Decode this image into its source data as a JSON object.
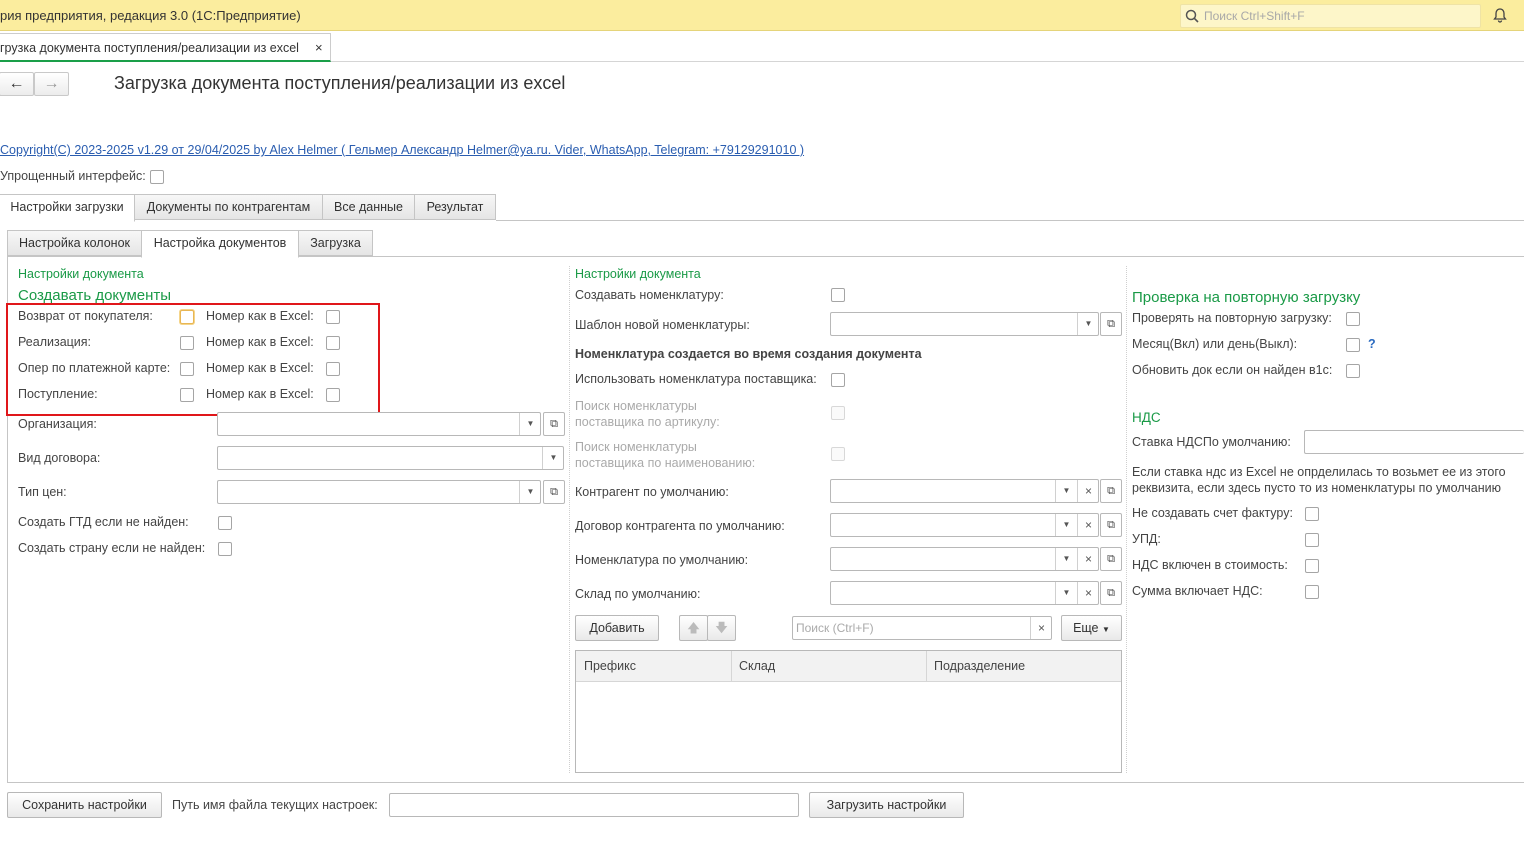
{
  "titlebar": {
    "app_title": "рия предприятия, редакция 3.0  (1С:Предприятие)",
    "search_placeholder": "Поиск Ctrl+Shift+F"
  },
  "doc_tab": {
    "label": "грузка документа поступления/реализации из excel",
    "close": "×"
  },
  "nav": {
    "back": "←",
    "forward": "→"
  },
  "page_title": "Загрузка документа поступления/реализации из excel",
  "copyright_link": "Copyright(C)  2023-2025 v1.29 от 29/04/2025  by Alex Helmer ( Гельмер Александр Helmer@ya.ru. Vider, WhatsApp, Telegram: +79129291010 )",
  "simple_ui_label": "Упрощенный интерфейс:",
  "main_tabs": [
    "Настройки загрузки",
    "Документы по контрагентам",
    "Все данные",
    "Результат"
  ],
  "sub_tabs": [
    "Настройка колонок",
    "Настройка документов",
    "Загрузка"
  ],
  "left": {
    "group_title": "Настройки документа",
    "create_docs_title": "Создавать документы",
    "doc_rows": [
      {
        "label": "Возврат от покупателя:",
        "number_label": "Номер как в Excel:"
      },
      {
        "label": "Реализация:",
        "number_label": "Номер как в Excel:"
      },
      {
        "label": "Опер по платежной карте:",
        "number_label": "Номер как в Excel:"
      },
      {
        "label": "Поступление:",
        "number_label": "Номер как в Excel:"
      }
    ],
    "organization_label": "Организация:",
    "contract_type_label": "Вид договора:",
    "price_type_label": "Тип цен:",
    "create_gtd_label": "Создать ГТД если не найден:",
    "create_country_label": "Создать страну если не найден:"
  },
  "middle": {
    "group_title": "Настройки документа",
    "create_nomenclature_label": "Создавать номенклатуру:",
    "template_label": "Шаблон новой номенклатуры:",
    "section_title": "Номенклатура создается во время создания документа",
    "use_supplier_label": "Использовать номенклатура поставщика:",
    "search_by_article_line1": "Поиск номенклатуры",
    "search_by_article_line2": "поставщика по артикулу:",
    "search_by_name_line1": "Поиск номенклатуры",
    "search_by_name_line2": "поставщика по наименованию:",
    "counterparty_label": "Контрагент по умолчанию:",
    "contract_label": "Договор контрагента по умолчанию:",
    "nomenclature_label": "Номенклатура по умолчанию:",
    "warehouse_label": "Склад по умолчанию:",
    "add_button": "Добавить",
    "search_placeholder": "Поиск (Ctrl+F)",
    "more_button": "Еще",
    "table_columns": [
      "Префикс",
      "Склад",
      "Подразделение"
    ]
  },
  "right": {
    "recheck_title": "Проверка на повторную загрузку",
    "check_repeat_label": "Проверять на повторную загрузку:",
    "month_day_label": "Месяц(Вкл) или день(Выкл):",
    "help_mark": "?",
    "update_doc_label": "Обновить док если он найден в1с:",
    "vat_title": "НДС",
    "vat_rate_label": "Ставка НДСПо умолчанию:",
    "vat_note_line1": "Если ставка ндс из Excel не опрделилась то возьмет ее из этого",
    "vat_note_line2": "реквизита, если здесь пусто то из номенклатуры по умолчанию",
    "no_invoice_label": "Не создавать счет фактуру:",
    "upd_label": "УПД:",
    "vat_included_label": "НДС включен в стоимость:",
    "sum_includes_vat_label": "Сумма включает НДС:"
  },
  "footer": {
    "save_button": "Сохранить настройки",
    "path_label": "Путь имя файла текущих настроек:",
    "load_button": "Загрузить настройки"
  },
  "colors": {
    "titlebar": "#fbed9e",
    "group_green": "#1a9a47",
    "link_blue": "#2a5db0",
    "highlight_red": "#e0161a"
  }
}
